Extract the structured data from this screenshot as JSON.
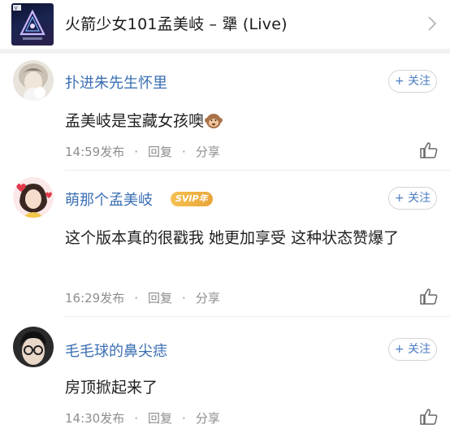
{
  "song": {
    "title": "火箭少女101孟美岐 – 犟 (Live)",
    "cover_badge": "V",
    "cover_caption": "火箭少女101"
  },
  "follow_label": "+ 关注",
  "comments": [
    {
      "username": "扑进朱先生怀里",
      "text": "孟美岐是宝藏女孩噢",
      "emoji": "monkey-emoji",
      "time": "14:59发布",
      "reply": "回复",
      "share": "分享"
    },
    {
      "username": "萌那个孟美岐",
      "badge": "SVIP年",
      "text": "这个版本真的很戳我 她更加享受 这种状态赞爆了",
      "time": "16:29发布",
      "reply": "回复",
      "share": "分享"
    },
    {
      "username": "毛毛球的鼻尖痣",
      "text": "房顶掀起来了",
      "time": "14:30发布",
      "reply": "回复",
      "share": "分享"
    }
  ],
  "colors": {
    "username": "#3b6fb3",
    "meta": "#8e8e8e",
    "badge": "#f0b444"
  }
}
